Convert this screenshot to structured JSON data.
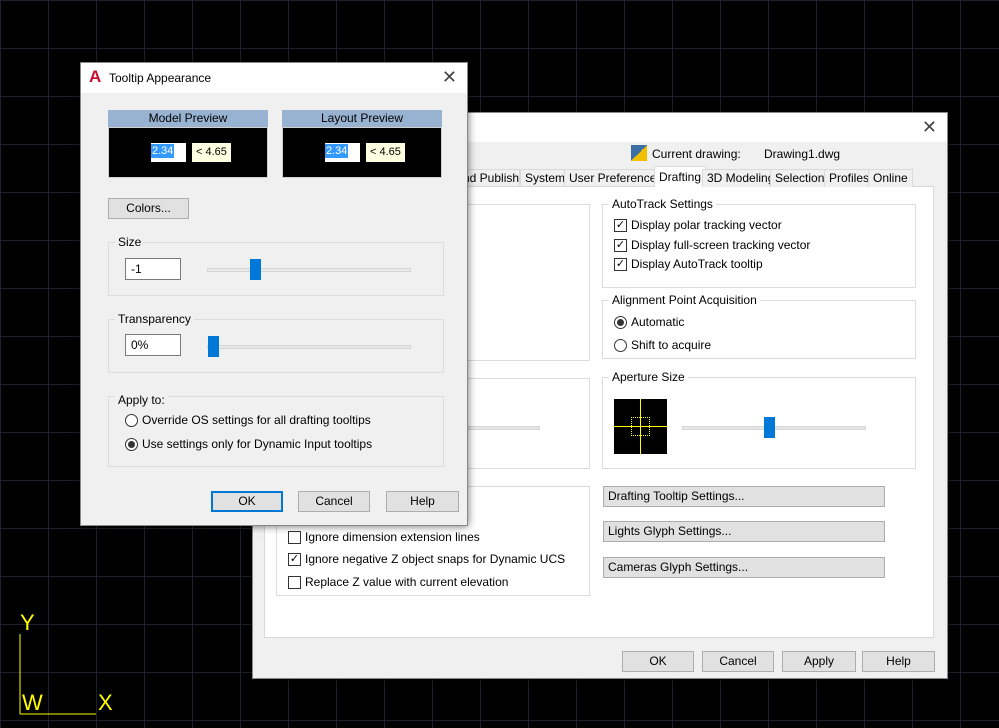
{
  "options_dialog": {
    "current_drawing_label": "Current drawing:",
    "current_drawing_value": "Drawing1.dwg",
    "tabs": [
      {
        "label": "nd Publish"
      },
      {
        "label": "System"
      },
      {
        "label": "User Preferences"
      },
      {
        "label": "Drafting",
        "active": true
      },
      {
        "label": "3D Modeling"
      },
      {
        "label": "Selection"
      },
      {
        "label": "Profiles"
      },
      {
        "label": "Online"
      }
    ],
    "autotrack": {
      "title": "AutoTrack Settings",
      "items": [
        {
          "label": "Display polar tracking vector",
          "checked": true
        },
        {
          "label": "Display full-screen tracking vector",
          "checked": true
        },
        {
          "label": "Display AutoTrack tooltip",
          "checked": true
        }
      ]
    },
    "alignment": {
      "title": "Alignment Point Acquisition",
      "options": [
        {
          "label": "Automatic",
          "selected": true
        },
        {
          "label": "Shift to acquire",
          "selected": false
        }
      ]
    },
    "aperture": {
      "title": "Aperture Size",
      "value": 0.55,
      "crosshair_color": "#ffff00"
    },
    "object_snap_options": [
      {
        "label": "Ignore dimension extension lines",
        "checked": false
      },
      {
        "label": "Ignore negative Z object snaps for Dynamic UCS",
        "checked": true
      },
      {
        "label": "Replace Z value with current elevation",
        "checked": false
      }
    ],
    "side_buttons": [
      "Drafting Tooltip Settings...",
      "Lights Glyph Settings...",
      "Cameras Glyph Settings..."
    ],
    "footer": {
      "ok": "OK",
      "cancel": "Cancel",
      "apply": "Apply",
      "help": "Help"
    }
  },
  "tooltip_dialog": {
    "title": "Tooltip Appearance",
    "model_preview": {
      "title": "Model Preview",
      "value": "2.34",
      "tip": "< 4.65"
    },
    "layout_preview": {
      "title": "Layout Preview",
      "value": "2.34",
      "tip": "< 4.65"
    },
    "colors_button": "Colors...",
    "size": {
      "label": "Size",
      "value": "-1",
      "slider": 0.23
    },
    "transparency": {
      "label": "Transparency",
      "value": "0%",
      "slider": 0.0
    },
    "apply_to": {
      "label": "Apply to:",
      "options": [
        {
          "label": "Override OS settings for all drafting tooltips",
          "selected": false
        },
        {
          "label": "Use settings only for Dynamic Input tooltips",
          "selected": true
        }
      ]
    },
    "footer": {
      "ok": "OK",
      "cancel": "Cancel",
      "help": "Help"
    }
  },
  "ucs_icon": {
    "y": "Y",
    "w": "W",
    "x": "X",
    "color": "#ffff00"
  }
}
